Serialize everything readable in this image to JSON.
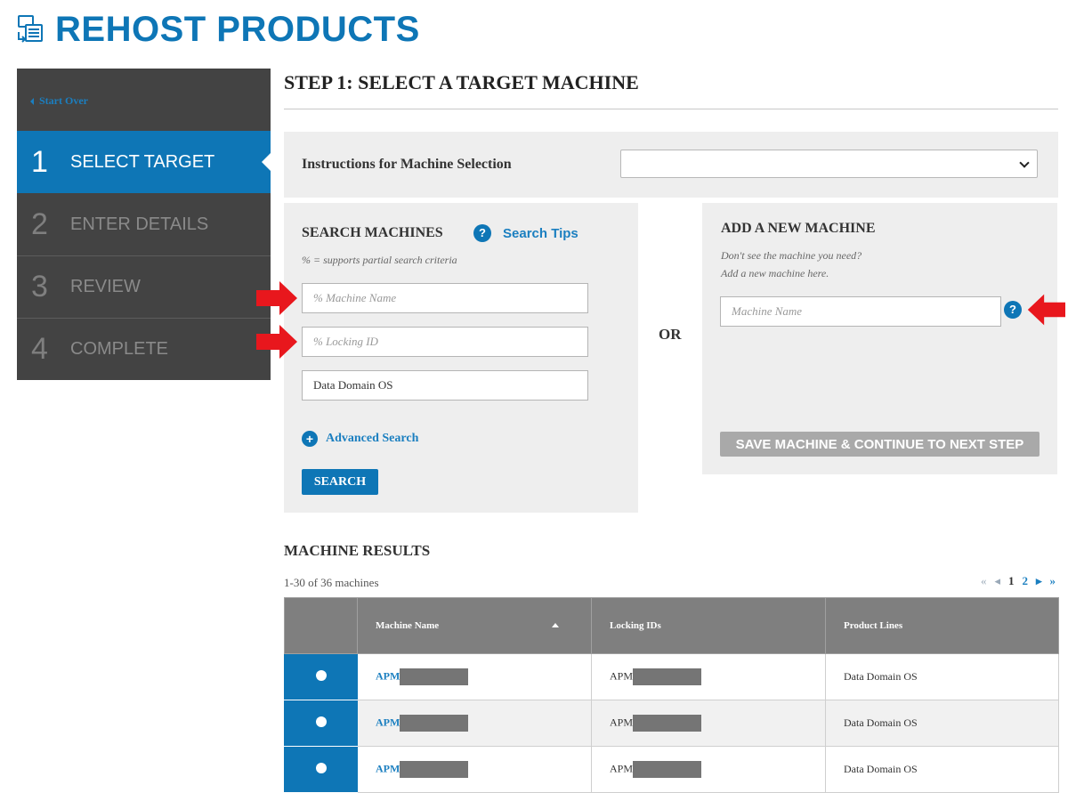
{
  "header": {
    "title": "REHOST PRODUCTS",
    "logo_icon": "rehost-products-icon"
  },
  "sidebar": {
    "start_over": "Start Over",
    "steps": [
      {
        "number": "1",
        "label": "SELECT TARGET",
        "active": true
      },
      {
        "number": "2",
        "label": "ENTER DETAILS",
        "active": false
      },
      {
        "number": "3",
        "label": "REVIEW",
        "active": false
      },
      {
        "number": "4",
        "label": "COMPLETE",
        "active": false
      }
    ]
  },
  "main": {
    "step_title": "STEP 1: SELECT A TARGET MACHINE",
    "instructions": {
      "label": "Instructions for Machine Selection",
      "selected": ""
    },
    "search": {
      "heading": "SEARCH MACHINES",
      "help_glyph": "?",
      "tips_link": "Search Tips",
      "hint": "% = supports partial search criteria",
      "machine_name_placeholder": "% Machine Name",
      "locking_id_placeholder": "% Locking ID",
      "product_line_value": "Data Domain OS",
      "advanced_search": "Advanced Search",
      "search_button": "SEARCH"
    },
    "or_label": "OR",
    "add_machine": {
      "heading": "ADD A NEW MACHINE",
      "hint_line1": "Don't see the machine you need?",
      "hint_line2": "Add a new machine here.",
      "machine_name_placeholder": "Machine Name",
      "help_glyph": "?",
      "save_button": "SAVE MACHINE & CONTINUE TO NEXT STEP"
    },
    "results": {
      "heading": "MACHINE RESULTS",
      "count": "1-30 of 36 machines",
      "pagination": {
        "first": "«",
        "prev": "◂",
        "pages": [
          "1",
          "2"
        ],
        "current_page": "1",
        "next": "▸",
        "last": "»"
      },
      "columns": [
        "Machine Name",
        "Locking IDs",
        "Product Lines"
      ],
      "rows": [
        {
          "machine_name": "APM",
          "locking_id": "APM",
          "product_line": "Data Domain OS"
        },
        {
          "machine_name": "APM",
          "locking_id": "APM",
          "product_line": "Data Domain OS"
        },
        {
          "machine_name": "APM",
          "locking_id": "APM",
          "product_line": "Data Domain OS"
        }
      ]
    }
  },
  "colors": {
    "brand_blue": "#0e76b6",
    "sidebar_bg": "#434343",
    "panel_bg": "#eeeeee",
    "annotation_red": "#e8171d",
    "button_disabled": "#a9a9a9"
  }
}
